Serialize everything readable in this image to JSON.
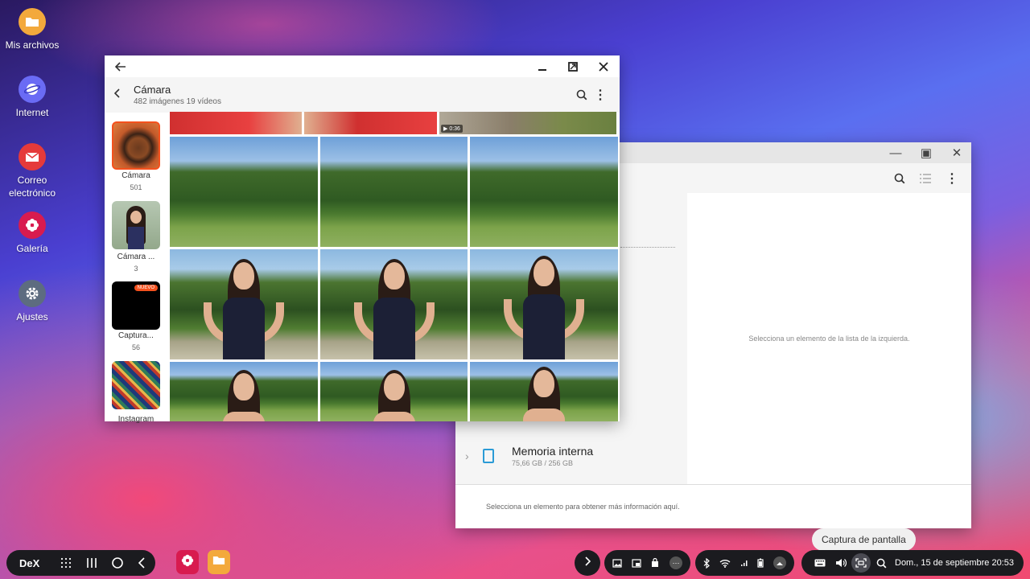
{
  "desktop": {
    "icons": [
      {
        "label": "Mis archivos",
        "icon": "folder-icon",
        "color": "#f3a93c"
      },
      {
        "label": "Internet",
        "icon": "internet-icon",
        "color": "#6a6bf5"
      },
      {
        "label": "Correo electrónico",
        "icon": "mail-icon",
        "color": "#e53a3a"
      },
      {
        "label": "Galería",
        "icon": "flower-icon",
        "color": "#d81b4f"
      },
      {
        "label": "Ajustes",
        "icon": "gear-icon",
        "color": "#5d6c80"
      }
    ]
  },
  "gallery": {
    "title": "Cámara",
    "subtitle": "482 imágenes  19 vídeos",
    "video_duration": "0:36",
    "albums": [
      {
        "name": "Cámara",
        "count": "501"
      },
      {
        "name": "Cámara ...",
        "count": "3"
      },
      {
        "name": "Captura...",
        "count": "56",
        "badge": "NUEVO"
      },
      {
        "name": "Instagram",
        "count": ""
      }
    ]
  },
  "files": {
    "placeholder": "Selecciona un elemento de la lista de la izquierda.",
    "storage_name": "Memoria interna",
    "storage_size": "75,66 GB / 256 GB",
    "footer": "Selecciona un elemento para obtener más información aquí."
  },
  "tooltip": "Captura de pantalla",
  "taskbar": {
    "dex": "DeX",
    "datetime": "Dom., 15 de septiembre 20:53"
  },
  "colors": {
    "accent": "#f4511e",
    "taskbar": "#1b1b1f"
  }
}
